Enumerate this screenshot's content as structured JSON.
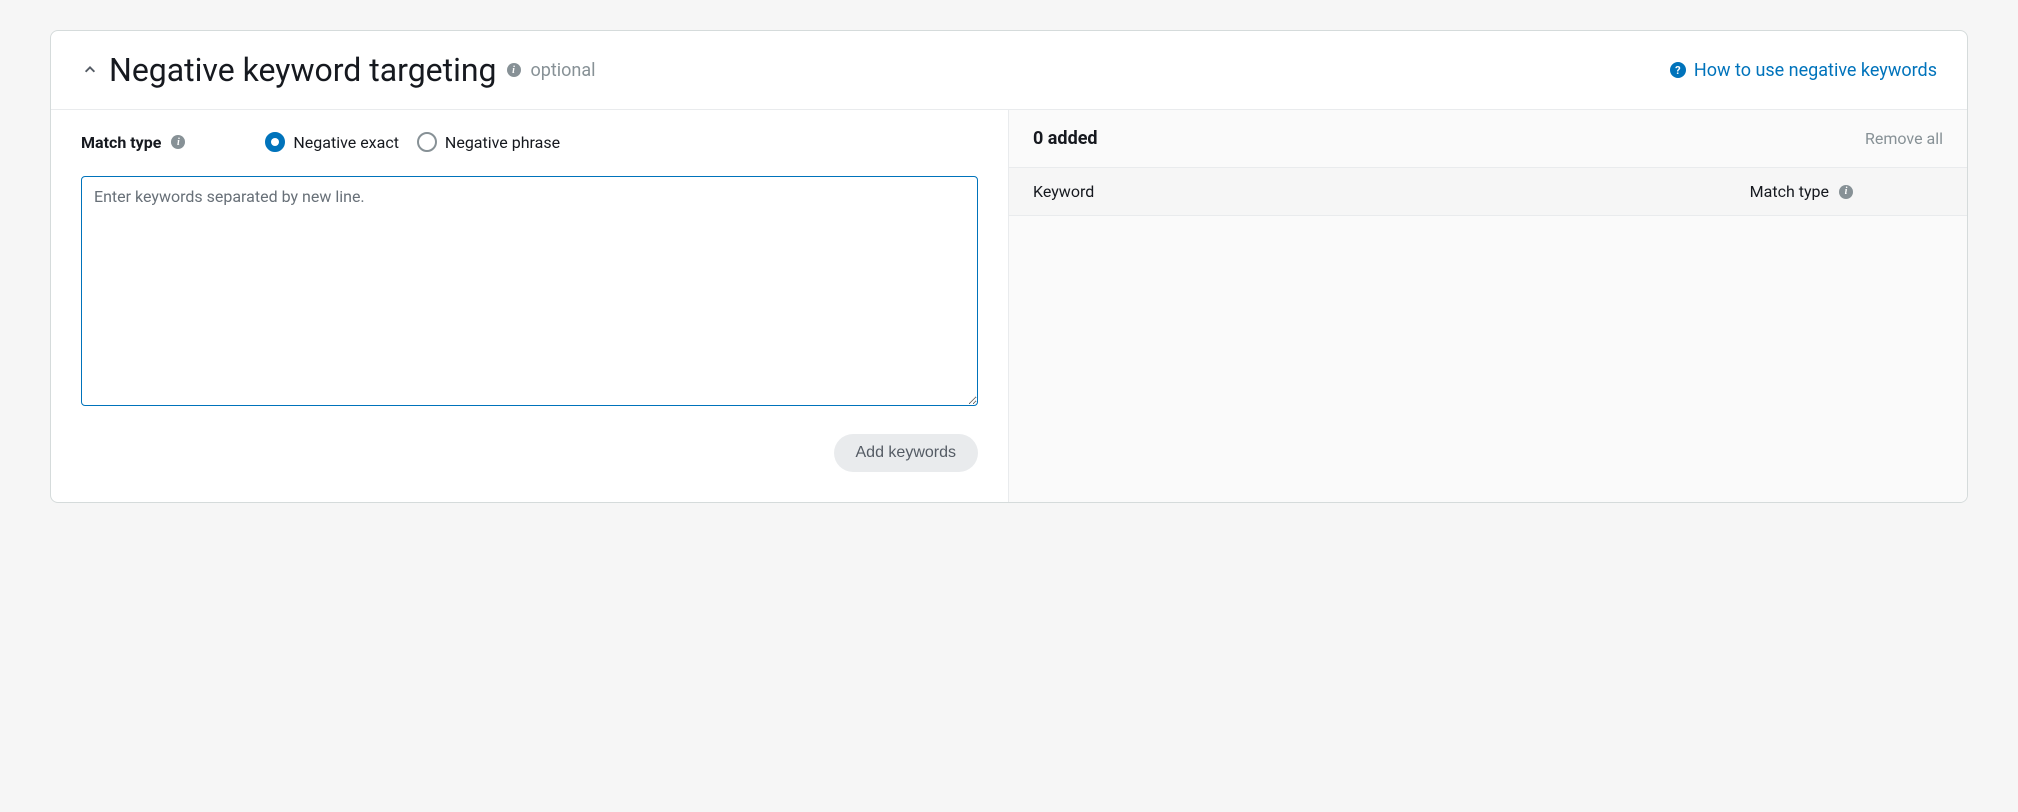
{
  "header": {
    "title": "Negative keyword targeting",
    "optional": "optional",
    "help_link": "How to use negative keywords"
  },
  "left": {
    "match_type_label": "Match type",
    "radio_exact": "Negative exact",
    "radio_phrase": "Negative phrase",
    "textarea_placeholder": "Enter keywords separated by new line.",
    "textarea_value": "",
    "add_button": "Add keywords"
  },
  "right": {
    "added_count": "0 added",
    "remove_all": "Remove all",
    "th_keyword": "Keyword",
    "th_match": "Match type"
  }
}
